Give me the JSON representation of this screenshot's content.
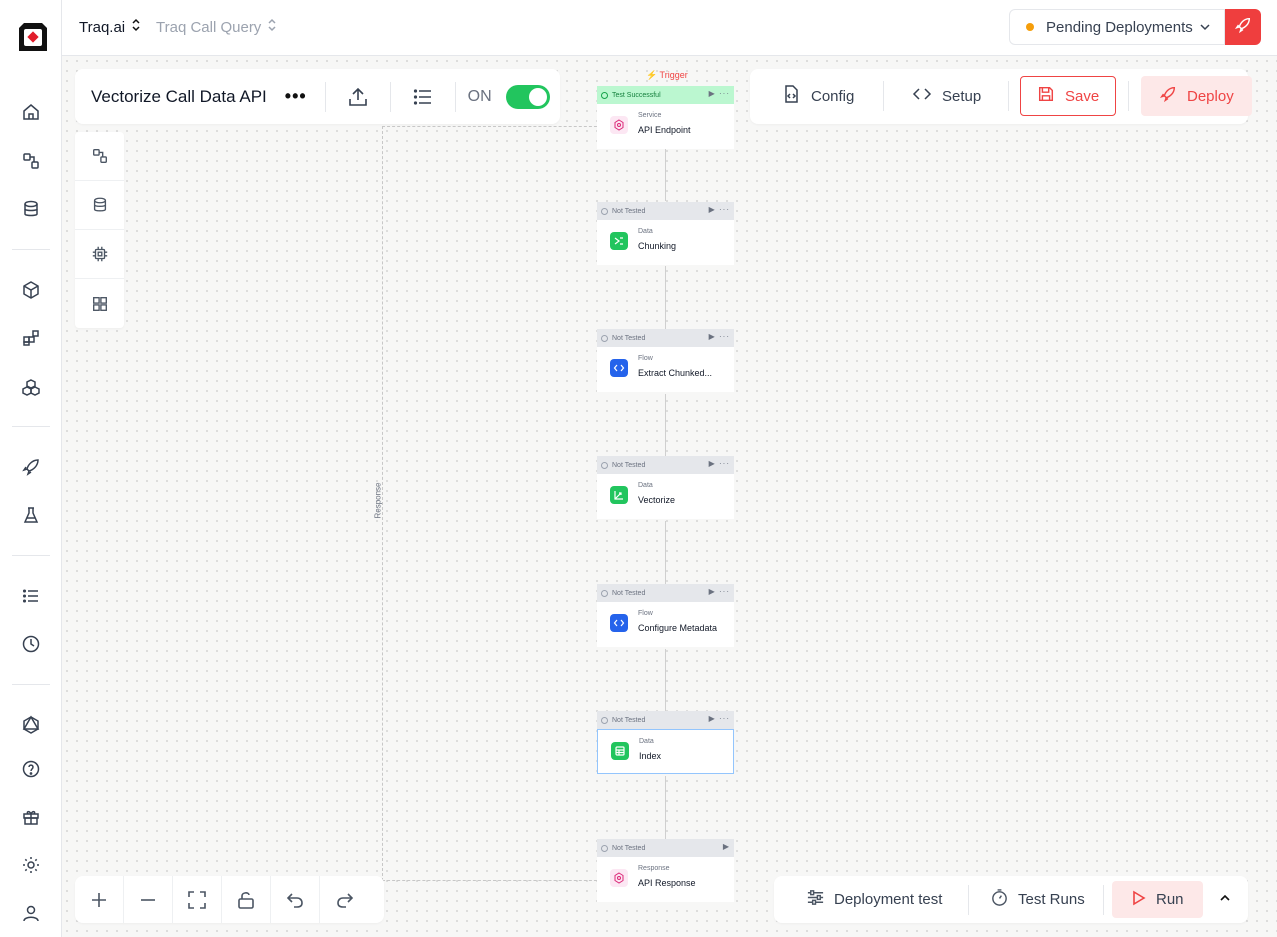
{
  "breadcrumb": {
    "org": "Traq.ai",
    "project": "Traq Call Query"
  },
  "header": {
    "pending_label": "Pending Deployments",
    "status_color": "#f59e0b",
    "accent_color": "#ef3e3e"
  },
  "workflow": {
    "title": "Vectorize Call Data API",
    "more": "•••",
    "toggle_label": "ON",
    "toggle_on": true
  },
  "toolbar": {
    "config_label": "Config",
    "setup_label": "Setup",
    "save_label": "Save",
    "deploy_label": "Deploy"
  },
  "canvas": {
    "trigger_label": "⚡ Trigger",
    "response_label": "Response",
    "nodes": [
      {
        "status": "Test Successful",
        "kind": "Service",
        "name": "API Endpoint",
        "icon": "service-icon"
      },
      {
        "status": "Not Tested",
        "kind": "Data",
        "name": "Chunking",
        "icon": "chunking-icon"
      },
      {
        "status": "Not Tested",
        "kind": "Flow",
        "name": "Extract Chunked...",
        "icon": "code-icon"
      },
      {
        "status": "Not Tested",
        "kind": "Data",
        "name": "Vectorize",
        "icon": "vectorize-icon"
      },
      {
        "status": "Not Tested",
        "kind": "Flow",
        "name": "Configure Metadata",
        "icon": "code-icon"
      },
      {
        "status": "Not Tested",
        "kind": "Data",
        "name": "Index",
        "icon": "index-icon"
      },
      {
        "status": "Not Tested",
        "kind": "Response",
        "name": "API Response",
        "icon": "service-icon"
      }
    ]
  },
  "bottom": {
    "deployment_test_label": "Deployment test",
    "test_runs_label": "Test Runs",
    "run_label": "Run"
  }
}
